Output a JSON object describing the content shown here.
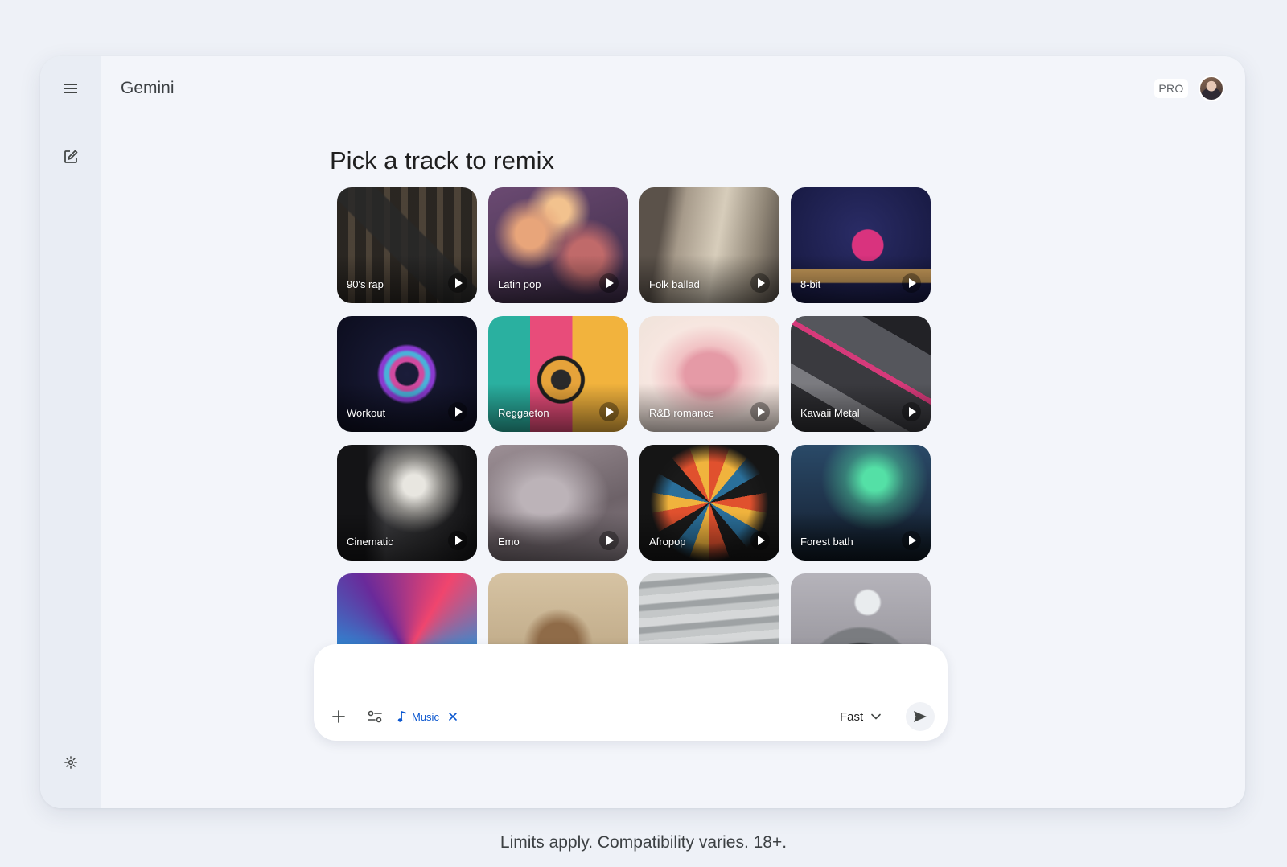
{
  "app": {
    "title": "Gemini",
    "plan_badge": "PRO"
  },
  "sidebar": {
    "menu_icon": "menu-icon",
    "new_chat_icon": "edit-icon",
    "settings_icon": "gear-icon"
  },
  "main": {
    "heading": "Pick a track to remix",
    "tracks": [
      {
        "label": "90's rap"
      },
      {
        "label": "Latin pop"
      },
      {
        "label": "Folk ballad"
      },
      {
        "label": "8-bit"
      },
      {
        "label": "Workout"
      },
      {
        "label": "Reggaeton"
      },
      {
        "label": "R&B romance"
      },
      {
        "label": "Kawaii Metal"
      },
      {
        "label": "Cinematic"
      },
      {
        "label": "Emo"
      },
      {
        "label": "Afropop"
      },
      {
        "label": "Forest bath"
      },
      {
        "label": ""
      },
      {
        "label": ""
      },
      {
        "label": ""
      },
      {
        "label": ""
      }
    ]
  },
  "composer": {
    "placeholder": "",
    "tool_chip": "Music",
    "model": "Fast",
    "icons": [
      "plus-icon",
      "tools-icon",
      "music-note-icon",
      "close-icon",
      "chevron-down-icon",
      "send-icon"
    ]
  },
  "footer": {
    "disclaimer": "Limits apply. Compatibility varies. 18+."
  },
  "colors": {
    "accent": "#0b57d0",
    "page_background": "#eef1f7",
    "window_background": "#f3f5fa",
    "rail_background": "#e9edf4"
  }
}
